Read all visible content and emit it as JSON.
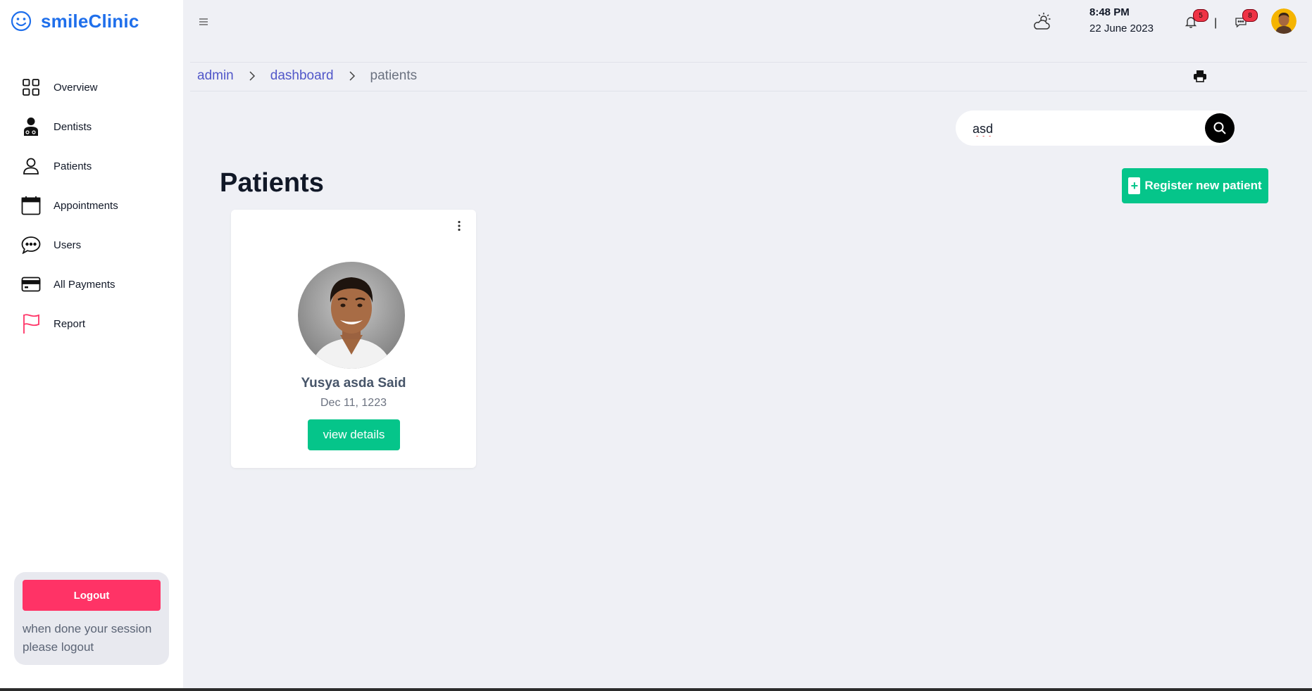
{
  "app": {
    "brand": "smileClinic"
  },
  "sidebar": {
    "items": [
      {
        "label": "Overview",
        "icon": "grid-icon"
      },
      {
        "label": "Dentists",
        "icon": "doctor-icon"
      },
      {
        "label": "Patients",
        "icon": "person-icon"
      },
      {
        "label": "Appointments",
        "icon": "calendar-icon"
      },
      {
        "label": "Users",
        "icon": "chat-bubble-icon"
      },
      {
        "label": "All Payments",
        "icon": "credit-card-icon"
      },
      {
        "label": "Report",
        "icon": "flag-icon"
      }
    ],
    "logout_label": "Logout",
    "logout_note": "when done your session please logout"
  },
  "header": {
    "time": "8:48 PM",
    "date": "22 June 2023",
    "notifications_count": "5",
    "messages_count": "8",
    "separator": "|"
  },
  "breadcrumb": {
    "items": [
      "admin",
      "dashboard",
      "patients"
    ]
  },
  "search": {
    "value": "asd"
  },
  "main": {
    "title": "Patients",
    "register_label": "Register new patient",
    "register_plus": "+"
  },
  "patients": [
    {
      "name": "Yusya asda Said",
      "date": "Dec 11, 1223",
      "action_label": "view details"
    }
  ],
  "colors": {
    "brand": "#1f6feb",
    "accent_green": "#05c58a",
    "logout_red": "#ff3366",
    "breadcrumb_link": "#5157c9",
    "badge_red": "#ef3345"
  }
}
